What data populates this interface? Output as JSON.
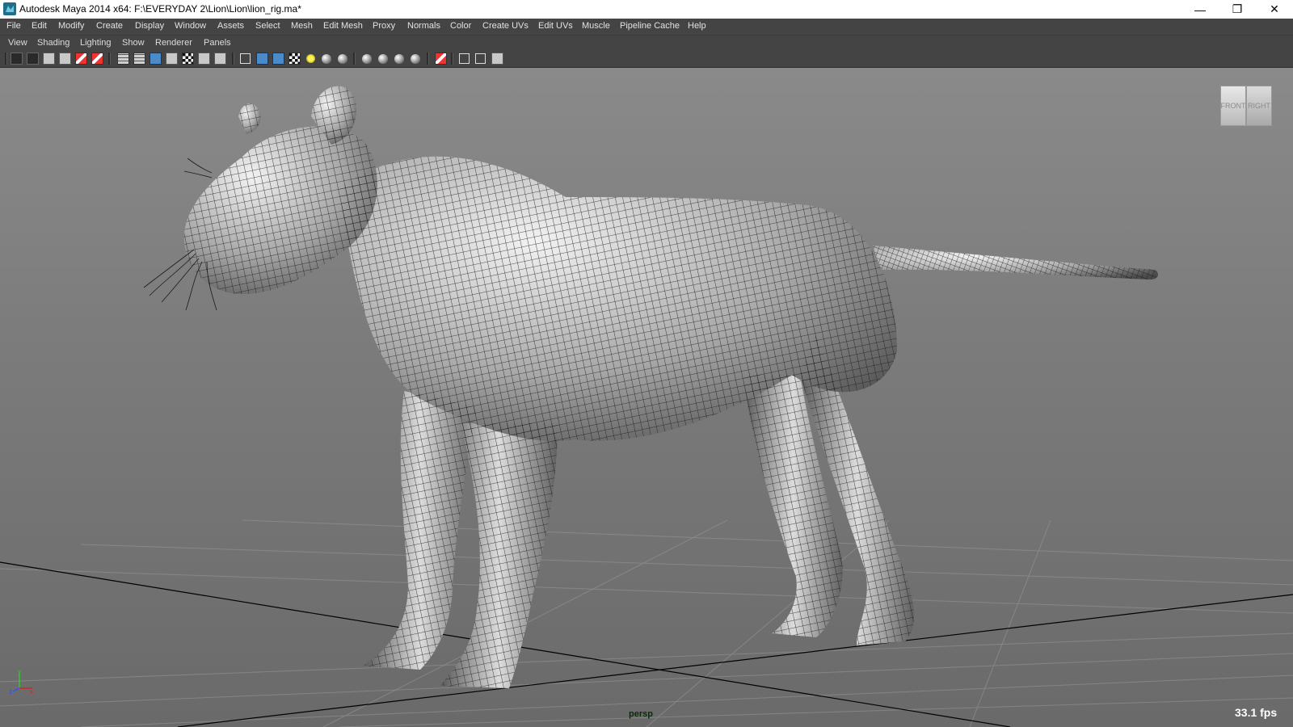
{
  "window": {
    "title": "Autodesk Maya 2014 x64: F:\\EVERYDAY 2\\Lion\\Lion\\lion_rig.ma*",
    "minimize_glyph": "—",
    "maximize_glyph": "❐",
    "close_glyph": "✕"
  },
  "main_menu": [
    "File",
    "Edit",
    "Modify",
    "Create",
    "Display",
    "Window",
    "Assets",
    "Select",
    "Mesh",
    "Edit Mesh",
    "Proxy",
    "Normals",
    "Color",
    "Create UVs",
    "Edit UVs",
    "Muscle",
    "Pipeline Cache",
    "Help"
  ],
  "panel_menu": [
    "View",
    "Shading",
    "Lighting",
    "Show",
    "Renderer",
    "Panels"
  ],
  "toolbar_icons": [
    "camera-select-icon",
    "camera-attributes-icon",
    "bookmarks-icon",
    "image-plane-icon",
    "2d-pan-zoom-icon",
    "grease-pencil-icon",
    "grid-icon",
    "film-gate-icon",
    "resolution-gate-icon",
    "gate-mask-icon",
    "field-chart-icon",
    "safe-action-icon",
    "safe-title-icon",
    "wireframe-icon",
    "smooth-shade-icon",
    "wireframe-on-shaded-icon",
    "textured-icon",
    "use-all-lights-icon",
    "shadows-icon",
    "screen-space-ao-icon",
    "motion-blur-icon",
    "multisample-aa-icon",
    "depth-of-field-icon",
    "isolate-select-icon",
    "xray-icon",
    "xray-active-components-icon",
    "xray-joints-icon"
  ],
  "viewport": {
    "camera": "persp",
    "fps": "33.1 fps",
    "viewcube_front": "FRONT",
    "viewcube_right": "RIGHT",
    "axis_x": "x",
    "axis_y": "y",
    "axis_z": "z",
    "colors": {
      "wire": "#1a1a1a",
      "mesh_light": "#f2f2f2",
      "mesh_dark": "#4a4a4a",
      "grid_line": "#9a9a9a",
      "axis_line": "#000000"
    }
  }
}
